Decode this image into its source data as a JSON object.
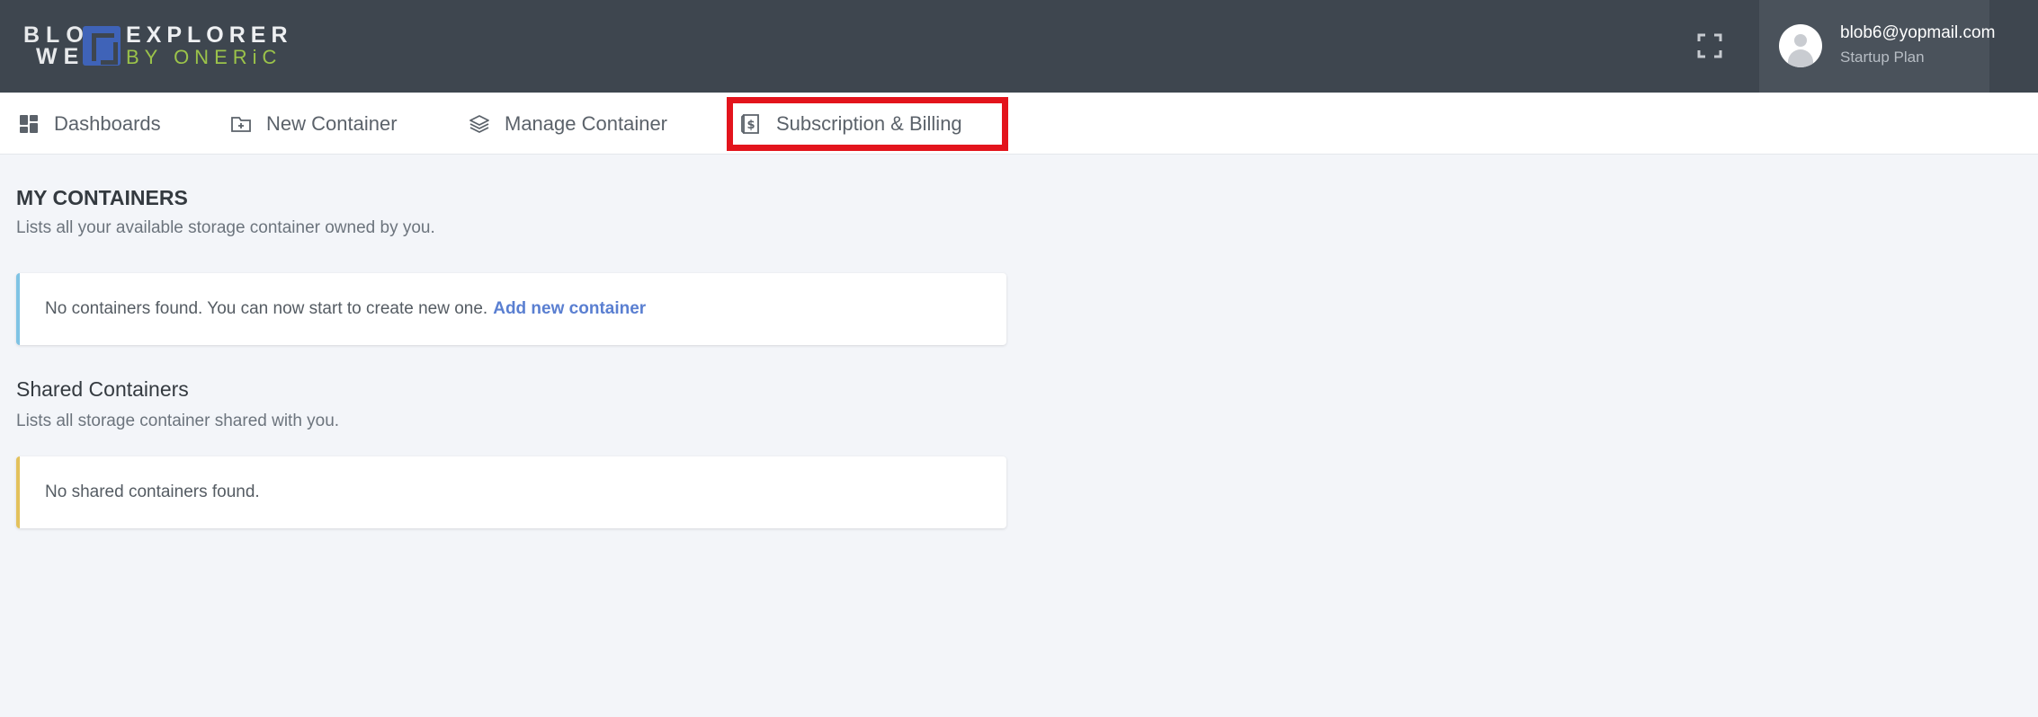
{
  "header": {
    "logo": {
      "row1": "BLO",
      "row2": "WE",
      "explorer": "EXPLORER",
      "byline": "BY ONERiC"
    },
    "fullscreen_icon": "expand-icon",
    "user": {
      "email": "blob6@yopmail.com",
      "plan": "Startup Plan"
    }
  },
  "nav": {
    "items": [
      {
        "label": "Dashboards",
        "icon": "dashboard-grid-icon"
      },
      {
        "label": "New Container",
        "icon": "folder-plus-icon"
      },
      {
        "label": "Manage Container",
        "icon": "layers-icon"
      },
      {
        "label": "Subscription & Billing",
        "icon": "billing-dollar-icon"
      }
    ],
    "highlighted": "Subscription & Billing"
  },
  "my_containers": {
    "title": "MY CONTAINERS",
    "subtitle": "Lists all your available storage container owned by you.",
    "empty_message": "No containers found. You can now start to create new one.",
    "add_link": "Add new container"
  },
  "shared_containers": {
    "title": "Shared Containers",
    "subtitle": "Lists all storage container shared with you.",
    "empty_message": "No shared containers found."
  },
  "colors": {
    "topbar": "#3e464f",
    "accent_blue": "#3f63b8",
    "accent_green": "#9bc34a",
    "highlight_red": "#e3141c",
    "info_border": "#7fc3e4",
    "warning_border": "#e3c15c",
    "link": "#5a7fd1"
  }
}
